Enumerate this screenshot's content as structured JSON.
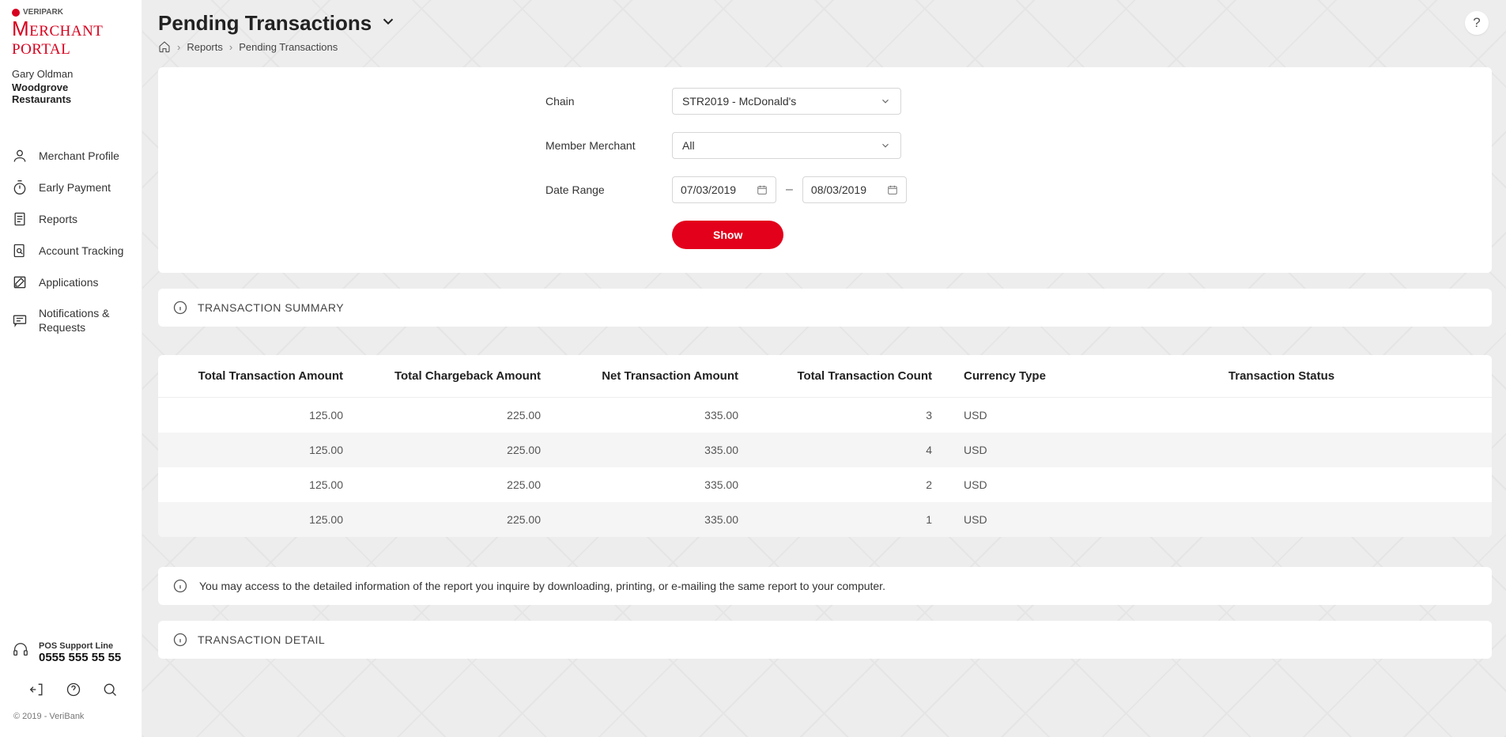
{
  "brand": {
    "small": "VERIPARK",
    "portal_html": "MERCHANT PORTAL"
  },
  "user": {
    "name": "Gary Oldman",
    "merchant": "Woodgrove Restaurants"
  },
  "sidebar": {
    "items": [
      {
        "label": "Merchant Profile"
      },
      {
        "label": "Early Payment"
      },
      {
        "label": "Reports"
      },
      {
        "label": "Account Tracking"
      },
      {
        "label": "Applications"
      },
      {
        "label": "Notifications & Requests"
      }
    ],
    "support_label": "POS Support Line",
    "support_phone": "0555 555 55 55",
    "copyright": "© 2019 - VeriBank"
  },
  "header": {
    "title": "Pending Transactions",
    "breadcrumb": {
      "l1": "Reports",
      "l2": "Pending Transactions"
    }
  },
  "filters": {
    "chain_label": "Chain",
    "chain_value": "STR2019 - McDonald's",
    "member_label": "Member Merchant",
    "member_value": "All",
    "daterange_label": "Date Range",
    "date_from": "07/03/2019",
    "date_to": "08/03/2019",
    "show_btn": "Show"
  },
  "summary": {
    "title": "TRANSACTION SUMMARY",
    "columns": {
      "amt": "Total Transaction Amount",
      "chb": "Total Chargeback Amount",
      "net": "Net Transaction Amount",
      "cnt": "Total Transaction Count",
      "cur": "Currency Type",
      "stat": "Transaction Status"
    },
    "rows": [
      {
        "amt": "125.00",
        "chb": "225.00",
        "net": "335.00",
        "cnt": "3",
        "cur": "USD",
        "stat": ""
      },
      {
        "amt": "125.00",
        "chb": "225.00",
        "net": "335.00",
        "cnt": "4",
        "cur": "USD",
        "stat": ""
      },
      {
        "amt": "125.00",
        "chb": "225.00",
        "net": "335.00",
        "cnt": "2",
        "cur": "USD",
        "stat": ""
      },
      {
        "amt": "125.00",
        "chb": "225.00",
        "net": "335.00",
        "cnt": "1",
        "cur": "USD",
        "stat": ""
      }
    ]
  },
  "info_text": "You may access to the detailed information of the report you inquire by downloading, printing, or e-mailing the same report to your computer.",
  "detail_title": "TRANSACTION DETAIL"
}
